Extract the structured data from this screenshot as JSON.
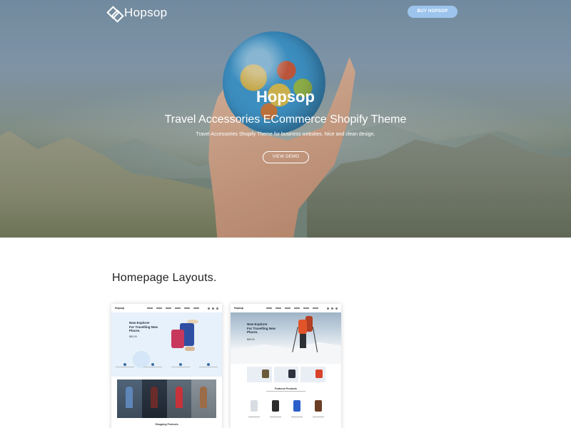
{
  "header": {
    "logo_text": "Hopsop",
    "buy_button": "BUY HOPSOP"
  },
  "hero": {
    "title": "Hopsop",
    "subtitle": "Travel Accessories ECommerce Shopify Theme",
    "description": "Travel Accessories Shopify Theme for business websites. Nice and clean design.",
    "demo_button": "VIEW DEMO"
  },
  "layouts": {
    "title": "Homepage Layouts.",
    "cards": [
      {
        "logo": "Hopsop",
        "headline_line1": "New Explorer",
        "headline_line2": "For Travelling New",
        "headline_line3": "Places.",
        "price": "$60.00",
        "section_label": "Shopping Products"
      },
      {
        "logo": "Hopsop",
        "headline_line1": "New Explorer",
        "headline_line2": "For Travelling New",
        "headline_line3": "Places.",
        "price": "$60.00",
        "section_label": "Featured Products"
      }
    ]
  },
  "colors": {
    "accent_button": "#9cc4ec",
    "text_dark": "#222222"
  }
}
